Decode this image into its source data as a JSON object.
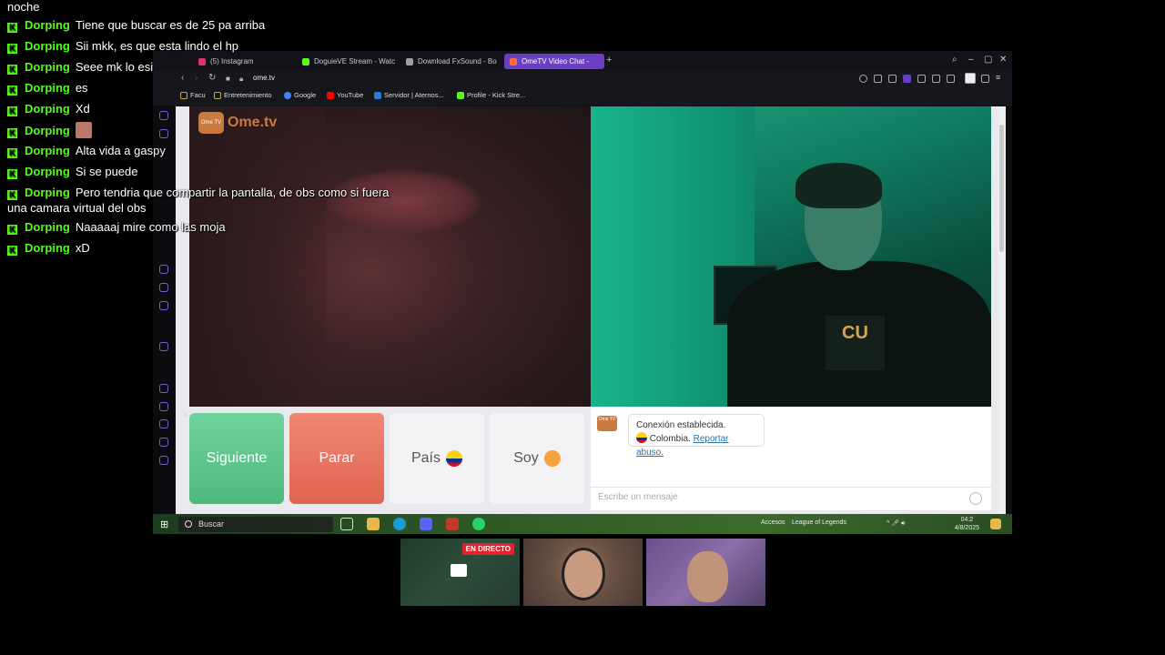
{
  "chat": {
    "top_fragment": "noche",
    "messages": [
      {
        "user": "Dorping",
        "text": "Tiene que buscar es de 25 pa arriba"
      },
      {
        "user": "Dorping",
        "text": "Sii mkk, es que esta lindo el hp"
      },
      {
        "user": "Dorping",
        "text": "Seee mk lo esi"
      },
      {
        "user": "Dorping",
        "text": "es"
      },
      {
        "user": "Dorping",
        "text": "Xd"
      },
      {
        "user": "Dorping",
        "text": ""
      },
      {
        "user": "Dorping",
        "text": "Alta vida a gaspy"
      },
      {
        "user": "Dorping",
        "text": "Si se puede"
      },
      {
        "user": "Dorping",
        "text": "Pero tendria que compartir la pantalla, de obs como si fuera",
        "text2": "una camara virtual del obs"
      },
      {
        "user": "Dorping",
        "text": "Naaaaaj mire como las moja"
      },
      {
        "user": "Dorping",
        "text": "xD"
      }
    ]
  },
  "browser": {
    "tabs": [
      {
        "label": "(5) Instagram",
        "color": "#e1306c"
      },
      {
        "label": "DoguieVE Stream - Watc",
        "color": "#53fc18"
      },
      {
        "label": "Download FxSound - Bo",
        "color": "#9aa0a6"
      },
      {
        "label": "OmeTV Video Chat -",
        "color": "#ff6a3d"
      }
    ],
    "new_tab": "+",
    "url": "ome.tv",
    "bookmarks": [
      {
        "label": "Facu",
        "color": "#c9a64a"
      },
      {
        "label": "Entretenimiento",
        "color": "#c9a64a"
      },
      {
        "label": "Google",
        "color": "#4285f4"
      },
      {
        "label": "YouTube",
        "color": "#ff0000"
      },
      {
        "label": "Servidor | Aternos...",
        "color": "#2b7bd6"
      },
      {
        "label": "Profile - Kick Stre...",
        "color": "#53fc18"
      }
    ]
  },
  "ometv": {
    "logo_mark": "Ome TV",
    "logo_text": "Ome.tv",
    "shirt_text": "CU",
    "buttons": {
      "next": "Siguiente",
      "stop": "Parar",
      "country": "País",
      "gender": "Soy"
    },
    "chat": {
      "logo": "Ome TV",
      "status": "Conexión establecida.",
      "country": "Colombia.",
      "report": "Reportar abuso.",
      "placeholder": "Escribe un mensaje"
    }
  },
  "taskbar": {
    "search_placeholder": "Buscar",
    "tray_access": "Accesos",
    "tray_game": "League of Legends",
    "time": "04:2",
    "date": "4/8/2025"
  },
  "stream": {
    "live_badge": "EN DIRECTO"
  },
  "colors": {
    "kick_green": "#53fc18",
    "ometv_orange": "#c97a40",
    "next_green": "#4fb97d",
    "stop_red": "#e06450",
    "active_tab": "#6b3fc4"
  }
}
